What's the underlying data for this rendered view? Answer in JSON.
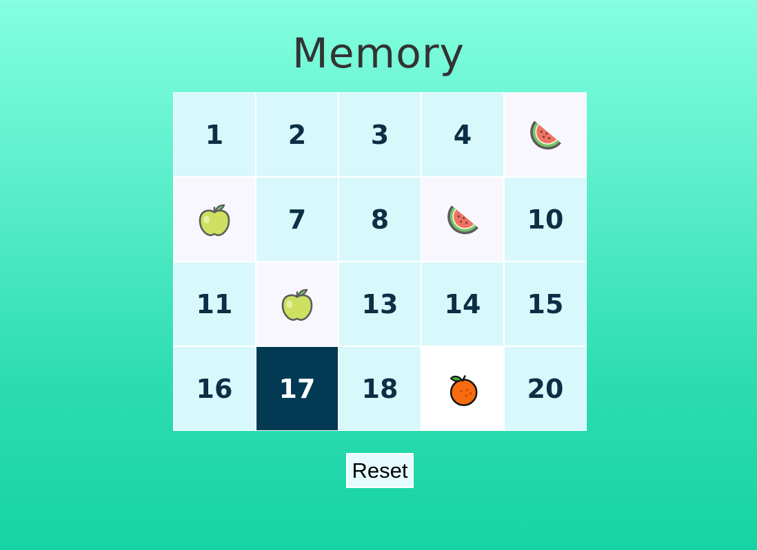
{
  "title": "Memory",
  "cards": [
    {
      "state": "hidden",
      "label": "1"
    },
    {
      "state": "hidden",
      "label": "2"
    },
    {
      "state": "hidden",
      "label": "3"
    },
    {
      "state": "hidden",
      "label": "4"
    },
    {
      "state": "matched",
      "icon": "watermelon-icon"
    },
    {
      "state": "matched",
      "icon": "apple-icon"
    },
    {
      "state": "hidden",
      "label": "7"
    },
    {
      "state": "hidden",
      "label": "8"
    },
    {
      "state": "matched",
      "icon": "watermelon-icon"
    },
    {
      "state": "hidden",
      "label": "10"
    },
    {
      "state": "hidden",
      "label": "11"
    },
    {
      "state": "matched",
      "icon": "apple-icon"
    },
    {
      "state": "hidden",
      "label": "13"
    },
    {
      "state": "hidden",
      "label": "14"
    },
    {
      "state": "hidden",
      "label": "15"
    },
    {
      "state": "hidden",
      "label": "16"
    },
    {
      "state": "selected",
      "label": "17"
    },
    {
      "state": "hidden",
      "label": "18"
    },
    {
      "state": "open",
      "icon": "orange-icon"
    },
    {
      "state": "hidden",
      "label": "20"
    }
  ],
  "reset_label": "Reset",
  "colors": {
    "card_hidden": "#d8f8fb",
    "card_matched": "#f8f7fd",
    "card_selected": "#033a53",
    "number_text": "#0c2f45"
  }
}
